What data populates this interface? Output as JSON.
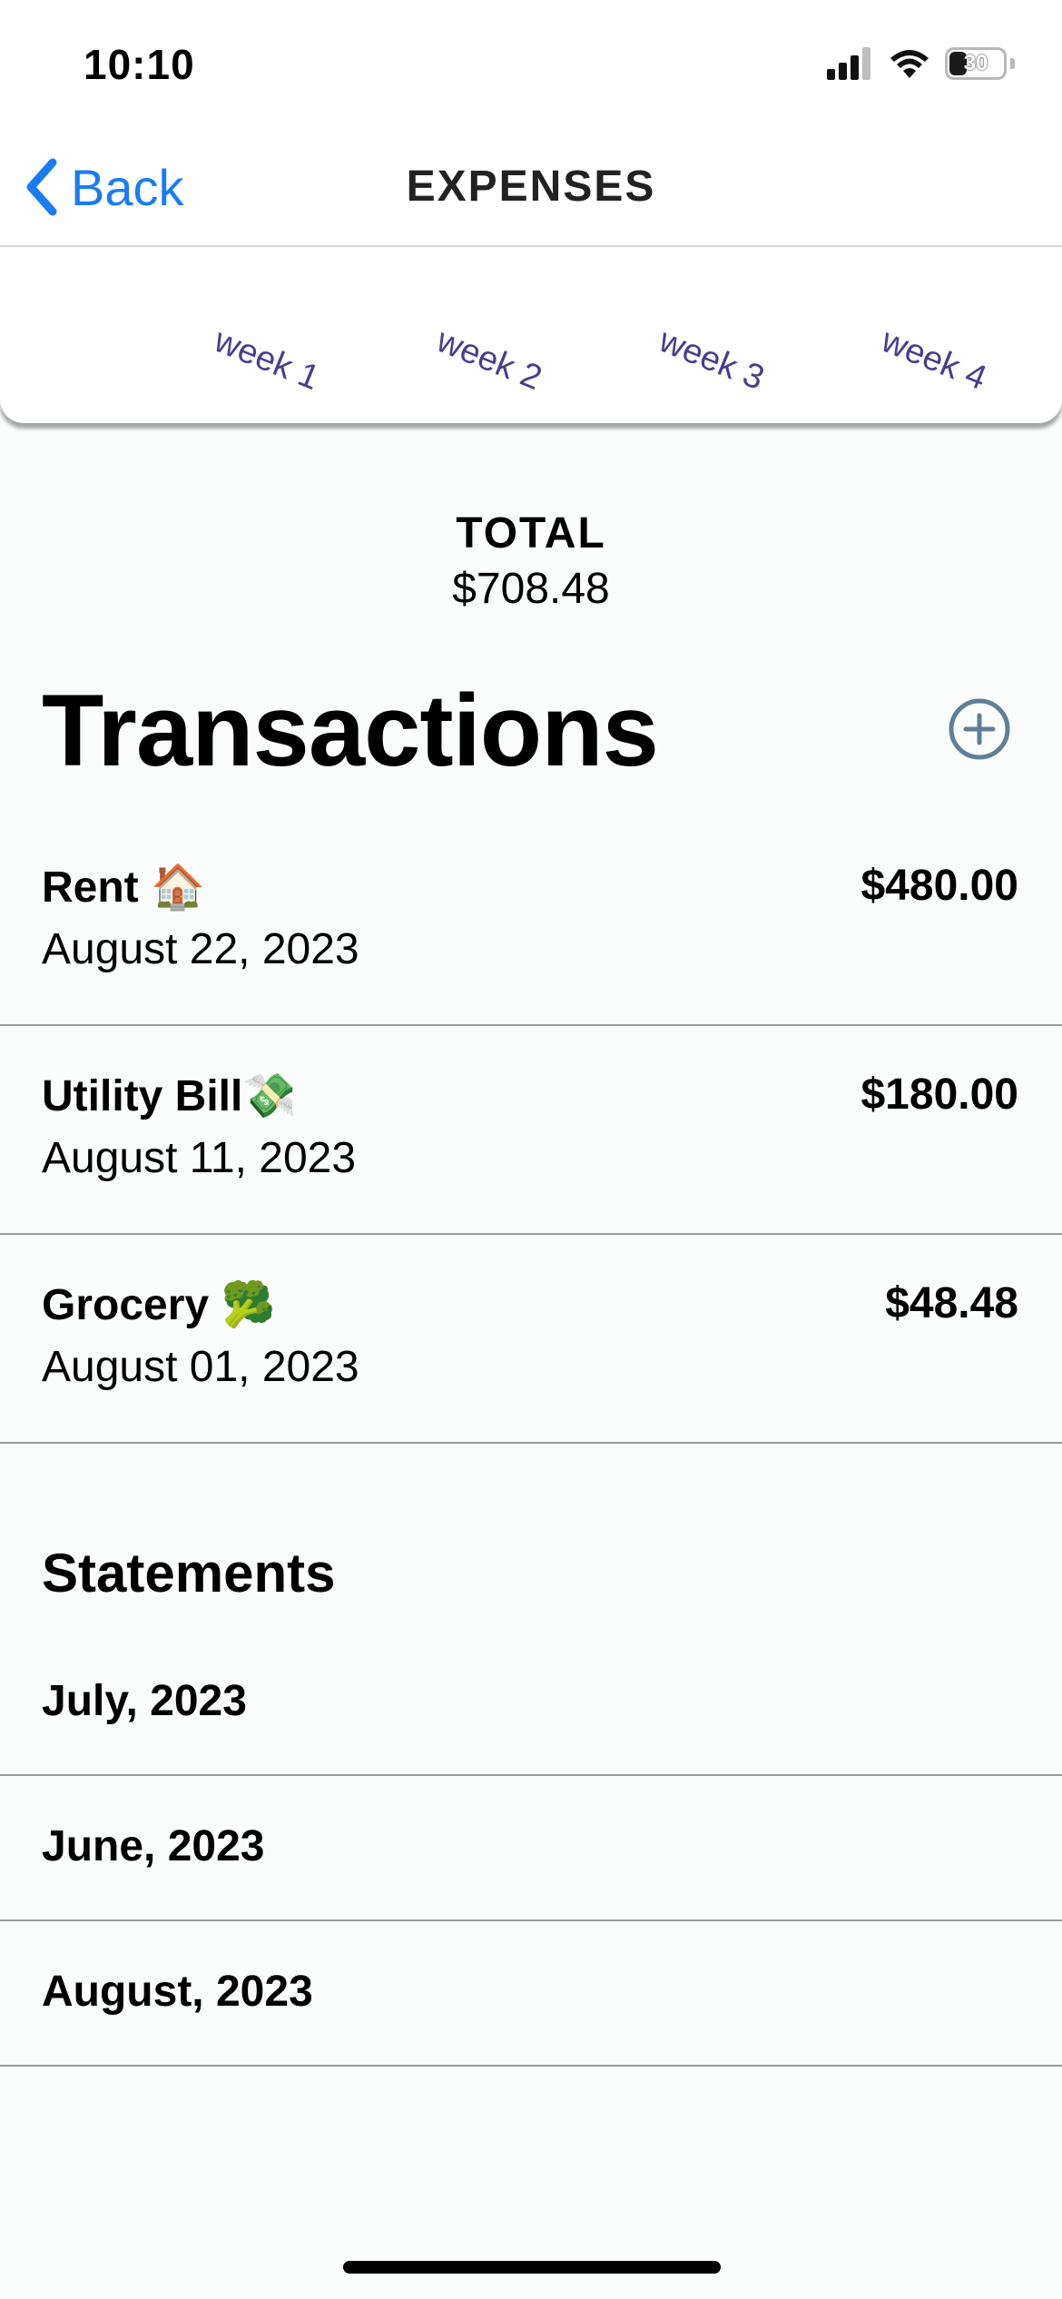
{
  "status_bar": {
    "time": "10:10",
    "battery_percent": "30",
    "battery_level": 0.3
  },
  "nav": {
    "back_label": "Back",
    "title": "EXPENSES"
  },
  "weeks": [
    "week 1",
    "week 2",
    "week 3",
    "week 4"
  ],
  "total": {
    "label": "TOTAL",
    "value": "$708.48"
  },
  "transactions": {
    "title": "Transactions",
    "items": [
      {
        "name": "Rent 🏠",
        "date": "August 22, 2023",
        "amount": "$480.00"
      },
      {
        "name": "Utility Bill💸",
        "date": "August 11, 2023",
        "amount": "$180.00"
      },
      {
        "name": "Grocery 🥦",
        "date": "August 01, 2023",
        "amount": "$48.48"
      }
    ]
  },
  "statements": {
    "title": "Statements",
    "items": [
      "July, 2023",
      "June, 2023",
      "August, 2023"
    ]
  },
  "colors": {
    "accent": "#1a7cf2",
    "week_text": "#4a3d8f",
    "add_icon": "#5f7f98"
  }
}
